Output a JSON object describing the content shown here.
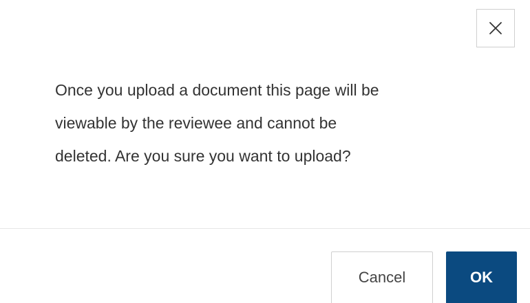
{
  "dialog": {
    "message_lines": [
      "Once you upload a document this page will be",
      "viewable by the reviewee and cannot be",
      "deleted. Are you sure you want to upload?"
    ],
    "close_icon": "close-icon",
    "buttons": {
      "cancel_label": "Cancel",
      "ok_label": "OK"
    }
  },
  "colors": {
    "primary": "#0b4a80",
    "text": "#333333",
    "border": "#cfcfcf"
  }
}
